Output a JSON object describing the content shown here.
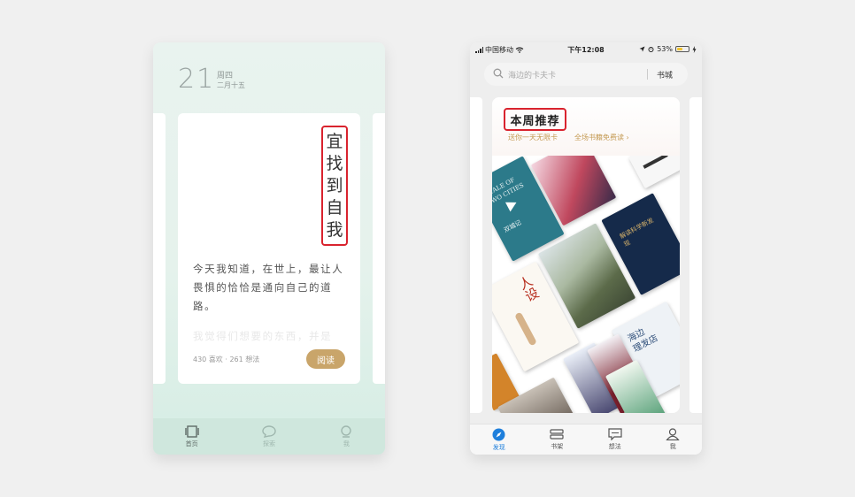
{
  "left_screen": {
    "date": {
      "day": "21",
      "weekday": "周四",
      "lunar": "二月十五"
    },
    "card": {
      "title_chars": [
        "宜",
        "找",
        "到",
        "自",
        "我"
      ],
      "excerpt": "今天我知道，在世上，最让人畏惧的恰恰是通向自己的道路。",
      "faded_line": "我觉得们想要的东西，并是",
      "stats": "430 喜欢 · 261 想法",
      "read_button": "阅读"
    },
    "tabs": [
      {
        "label": "首页",
        "icon": "home-icon",
        "active": true
      },
      {
        "label": "探索",
        "icon": "chat-bubble-icon",
        "active": false
      },
      {
        "label": "我",
        "icon": "user-icon",
        "active": false
      }
    ],
    "colors": {
      "accent": "#c9a56a",
      "highlight": "#d9232e",
      "background": "#e6f2ed"
    }
  },
  "right_screen": {
    "status_bar": {
      "carrier": "中国移动",
      "time": "下午12:08",
      "battery": "53%",
      "battery_level": 0.53
    },
    "search": {
      "placeholder": "海边的卡夫卡",
      "store_label": "书城"
    },
    "recommendation": {
      "title": "本周推荐",
      "subtitle_left": "送你一天无限卡",
      "subtitle_right": "全场书籍免费读 ›"
    },
    "covers": {
      "tale_title": "A TALE OF TWO CITIES",
      "tale_cn": "双城记",
      "rensheng": "人设",
      "dark_title": "解读科学新发现",
      "haibian_line1": "海边",
      "haibian_line2": "理发店"
    },
    "tabs": [
      {
        "label": "发现",
        "icon": "compass-icon",
        "active": true
      },
      {
        "label": "书架",
        "icon": "bookshelf-icon",
        "active": false
      },
      {
        "label": "想法",
        "icon": "message-icon",
        "active": false
      },
      {
        "label": "我",
        "icon": "user-icon",
        "active": false
      }
    ],
    "colors": {
      "active_tab": "#1e7fdc",
      "highlight": "#d9232e",
      "gold_text": "#c49a52"
    }
  }
}
